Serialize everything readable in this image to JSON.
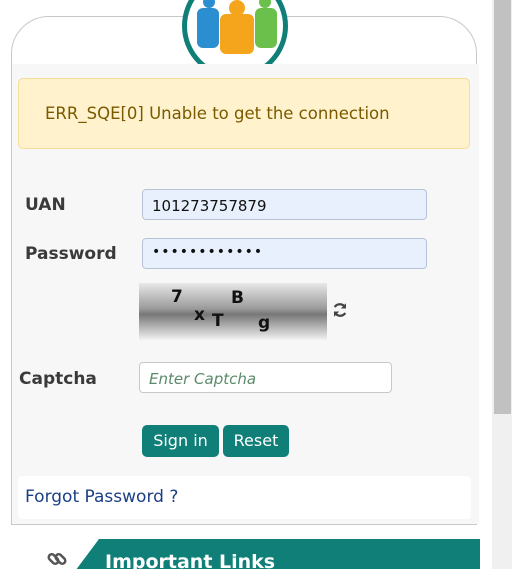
{
  "alert": {
    "message": "ERR_SQE[0] Unable to get the connection"
  },
  "form": {
    "uan_label": "UAN",
    "uan_value": "101273757879",
    "password_label": "Password",
    "password_value": "••••••••••••",
    "captcha_label": "Captcha",
    "captcha_placeholder": "Enter Captcha",
    "captcha_chars": [
      "7",
      "x",
      "T",
      "B",
      "g"
    ]
  },
  "buttons": {
    "sign_in": "Sign in",
    "reset": "Reset"
  },
  "links": {
    "forgot_password": "Forgot Password ?",
    "important_links": "Important Links"
  },
  "icons": {
    "refresh": "refresh-icon",
    "link": "link-icon",
    "logo": "people-logo-icon"
  },
  "colors": {
    "accent": "#0f7f77",
    "alert_bg": "#fff2cc",
    "alert_text": "#7a5a00",
    "link": "#1b3f86"
  }
}
